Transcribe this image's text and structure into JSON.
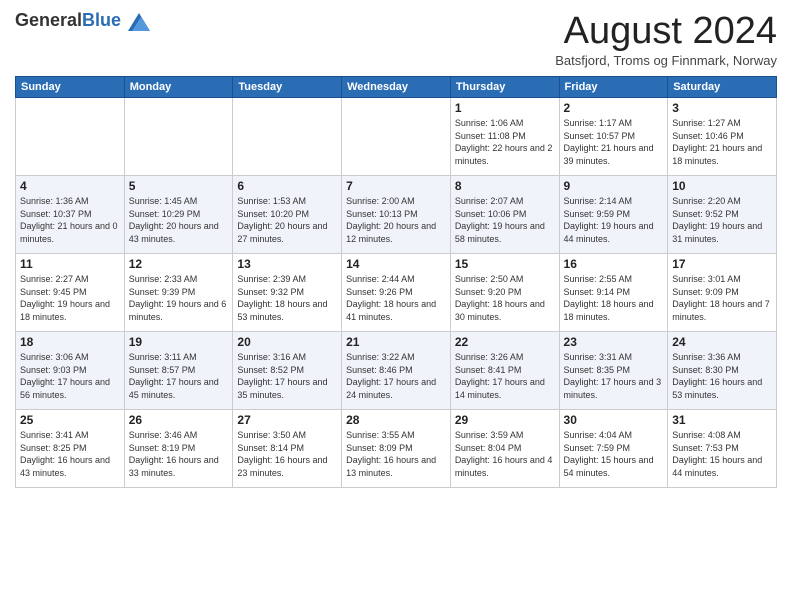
{
  "header": {
    "logo_general": "General",
    "logo_blue": "Blue",
    "month_title": "August 2024",
    "location": "Batsfjord, Troms og Finnmark, Norway"
  },
  "days_of_week": [
    "Sunday",
    "Monday",
    "Tuesday",
    "Wednesday",
    "Thursday",
    "Friday",
    "Saturday"
  ],
  "weeks": [
    [
      {
        "day": "",
        "info": ""
      },
      {
        "day": "",
        "info": ""
      },
      {
        "day": "",
        "info": ""
      },
      {
        "day": "",
        "info": ""
      },
      {
        "day": "1",
        "info": "Sunrise: 1:06 AM\nSunset: 11:08 PM\nDaylight: 22 hours and 2 minutes."
      },
      {
        "day": "2",
        "info": "Sunrise: 1:17 AM\nSunset: 10:57 PM\nDaylight: 21 hours and 39 minutes."
      },
      {
        "day": "3",
        "info": "Sunrise: 1:27 AM\nSunset: 10:46 PM\nDaylight: 21 hours and 18 minutes."
      }
    ],
    [
      {
        "day": "4",
        "info": "Sunrise: 1:36 AM\nSunset: 10:37 PM\nDaylight: 21 hours and 0 minutes."
      },
      {
        "day": "5",
        "info": "Sunrise: 1:45 AM\nSunset: 10:29 PM\nDaylight: 20 hours and 43 minutes."
      },
      {
        "day": "6",
        "info": "Sunrise: 1:53 AM\nSunset: 10:20 PM\nDaylight: 20 hours and 27 minutes."
      },
      {
        "day": "7",
        "info": "Sunrise: 2:00 AM\nSunset: 10:13 PM\nDaylight: 20 hours and 12 minutes."
      },
      {
        "day": "8",
        "info": "Sunrise: 2:07 AM\nSunset: 10:06 PM\nDaylight: 19 hours and 58 minutes."
      },
      {
        "day": "9",
        "info": "Sunrise: 2:14 AM\nSunset: 9:59 PM\nDaylight: 19 hours and 44 minutes."
      },
      {
        "day": "10",
        "info": "Sunrise: 2:20 AM\nSunset: 9:52 PM\nDaylight: 19 hours and 31 minutes."
      }
    ],
    [
      {
        "day": "11",
        "info": "Sunrise: 2:27 AM\nSunset: 9:45 PM\nDaylight: 19 hours and 18 minutes."
      },
      {
        "day": "12",
        "info": "Sunrise: 2:33 AM\nSunset: 9:39 PM\nDaylight: 19 hours and 6 minutes."
      },
      {
        "day": "13",
        "info": "Sunrise: 2:39 AM\nSunset: 9:32 PM\nDaylight: 18 hours and 53 minutes."
      },
      {
        "day": "14",
        "info": "Sunrise: 2:44 AM\nSunset: 9:26 PM\nDaylight: 18 hours and 41 minutes."
      },
      {
        "day": "15",
        "info": "Sunrise: 2:50 AM\nSunset: 9:20 PM\nDaylight: 18 hours and 30 minutes."
      },
      {
        "day": "16",
        "info": "Sunrise: 2:55 AM\nSunset: 9:14 PM\nDaylight: 18 hours and 18 minutes."
      },
      {
        "day": "17",
        "info": "Sunrise: 3:01 AM\nSunset: 9:09 PM\nDaylight: 18 hours and 7 minutes."
      }
    ],
    [
      {
        "day": "18",
        "info": "Sunrise: 3:06 AM\nSunset: 9:03 PM\nDaylight: 17 hours and 56 minutes."
      },
      {
        "day": "19",
        "info": "Sunrise: 3:11 AM\nSunset: 8:57 PM\nDaylight: 17 hours and 45 minutes."
      },
      {
        "day": "20",
        "info": "Sunrise: 3:16 AM\nSunset: 8:52 PM\nDaylight: 17 hours and 35 minutes."
      },
      {
        "day": "21",
        "info": "Sunrise: 3:22 AM\nSunset: 8:46 PM\nDaylight: 17 hours and 24 minutes."
      },
      {
        "day": "22",
        "info": "Sunrise: 3:26 AM\nSunset: 8:41 PM\nDaylight: 17 hours and 14 minutes."
      },
      {
        "day": "23",
        "info": "Sunrise: 3:31 AM\nSunset: 8:35 PM\nDaylight: 17 hours and 3 minutes."
      },
      {
        "day": "24",
        "info": "Sunrise: 3:36 AM\nSunset: 8:30 PM\nDaylight: 16 hours and 53 minutes."
      }
    ],
    [
      {
        "day": "25",
        "info": "Sunrise: 3:41 AM\nSunset: 8:25 PM\nDaylight: 16 hours and 43 minutes."
      },
      {
        "day": "26",
        "info": "Sunrise: 3:46 AM\nSunset: 8:19 PM\nDaylight: 16 hours and 33 minutes."
      },
      {
        "day": "27",
        "info": "Sunrise: 3:50 AM\nSunset: 8:14 PM\nDaylight: 16 hours and 23 minutes."
      },
      {
        "day": "28",
        "info": "Sunrise: 3:55 AM\nSunset: 8:09 PM\nDaylight: 16 hours and 13 minutes."
      },
      {
        "day": "29",
        "info": "Sunrise: 3:59 AM\nSunset: 8:04 PM\nDaylight: 16 hours and 4 minutes."
      },
      {
        "day": "30",
        "info": "Sunrise: 4:04 AM\nSunset: 7:59 PM\nDaylight: 15 hours and 54 minutes."
      },
      {
        "day": "31",
        "info": "Sunrise: 4:08 AM\nSunset: 7:53 PM\nDaylight: 15 hours and 44 minutes."
      }
    ]
  ]
}
